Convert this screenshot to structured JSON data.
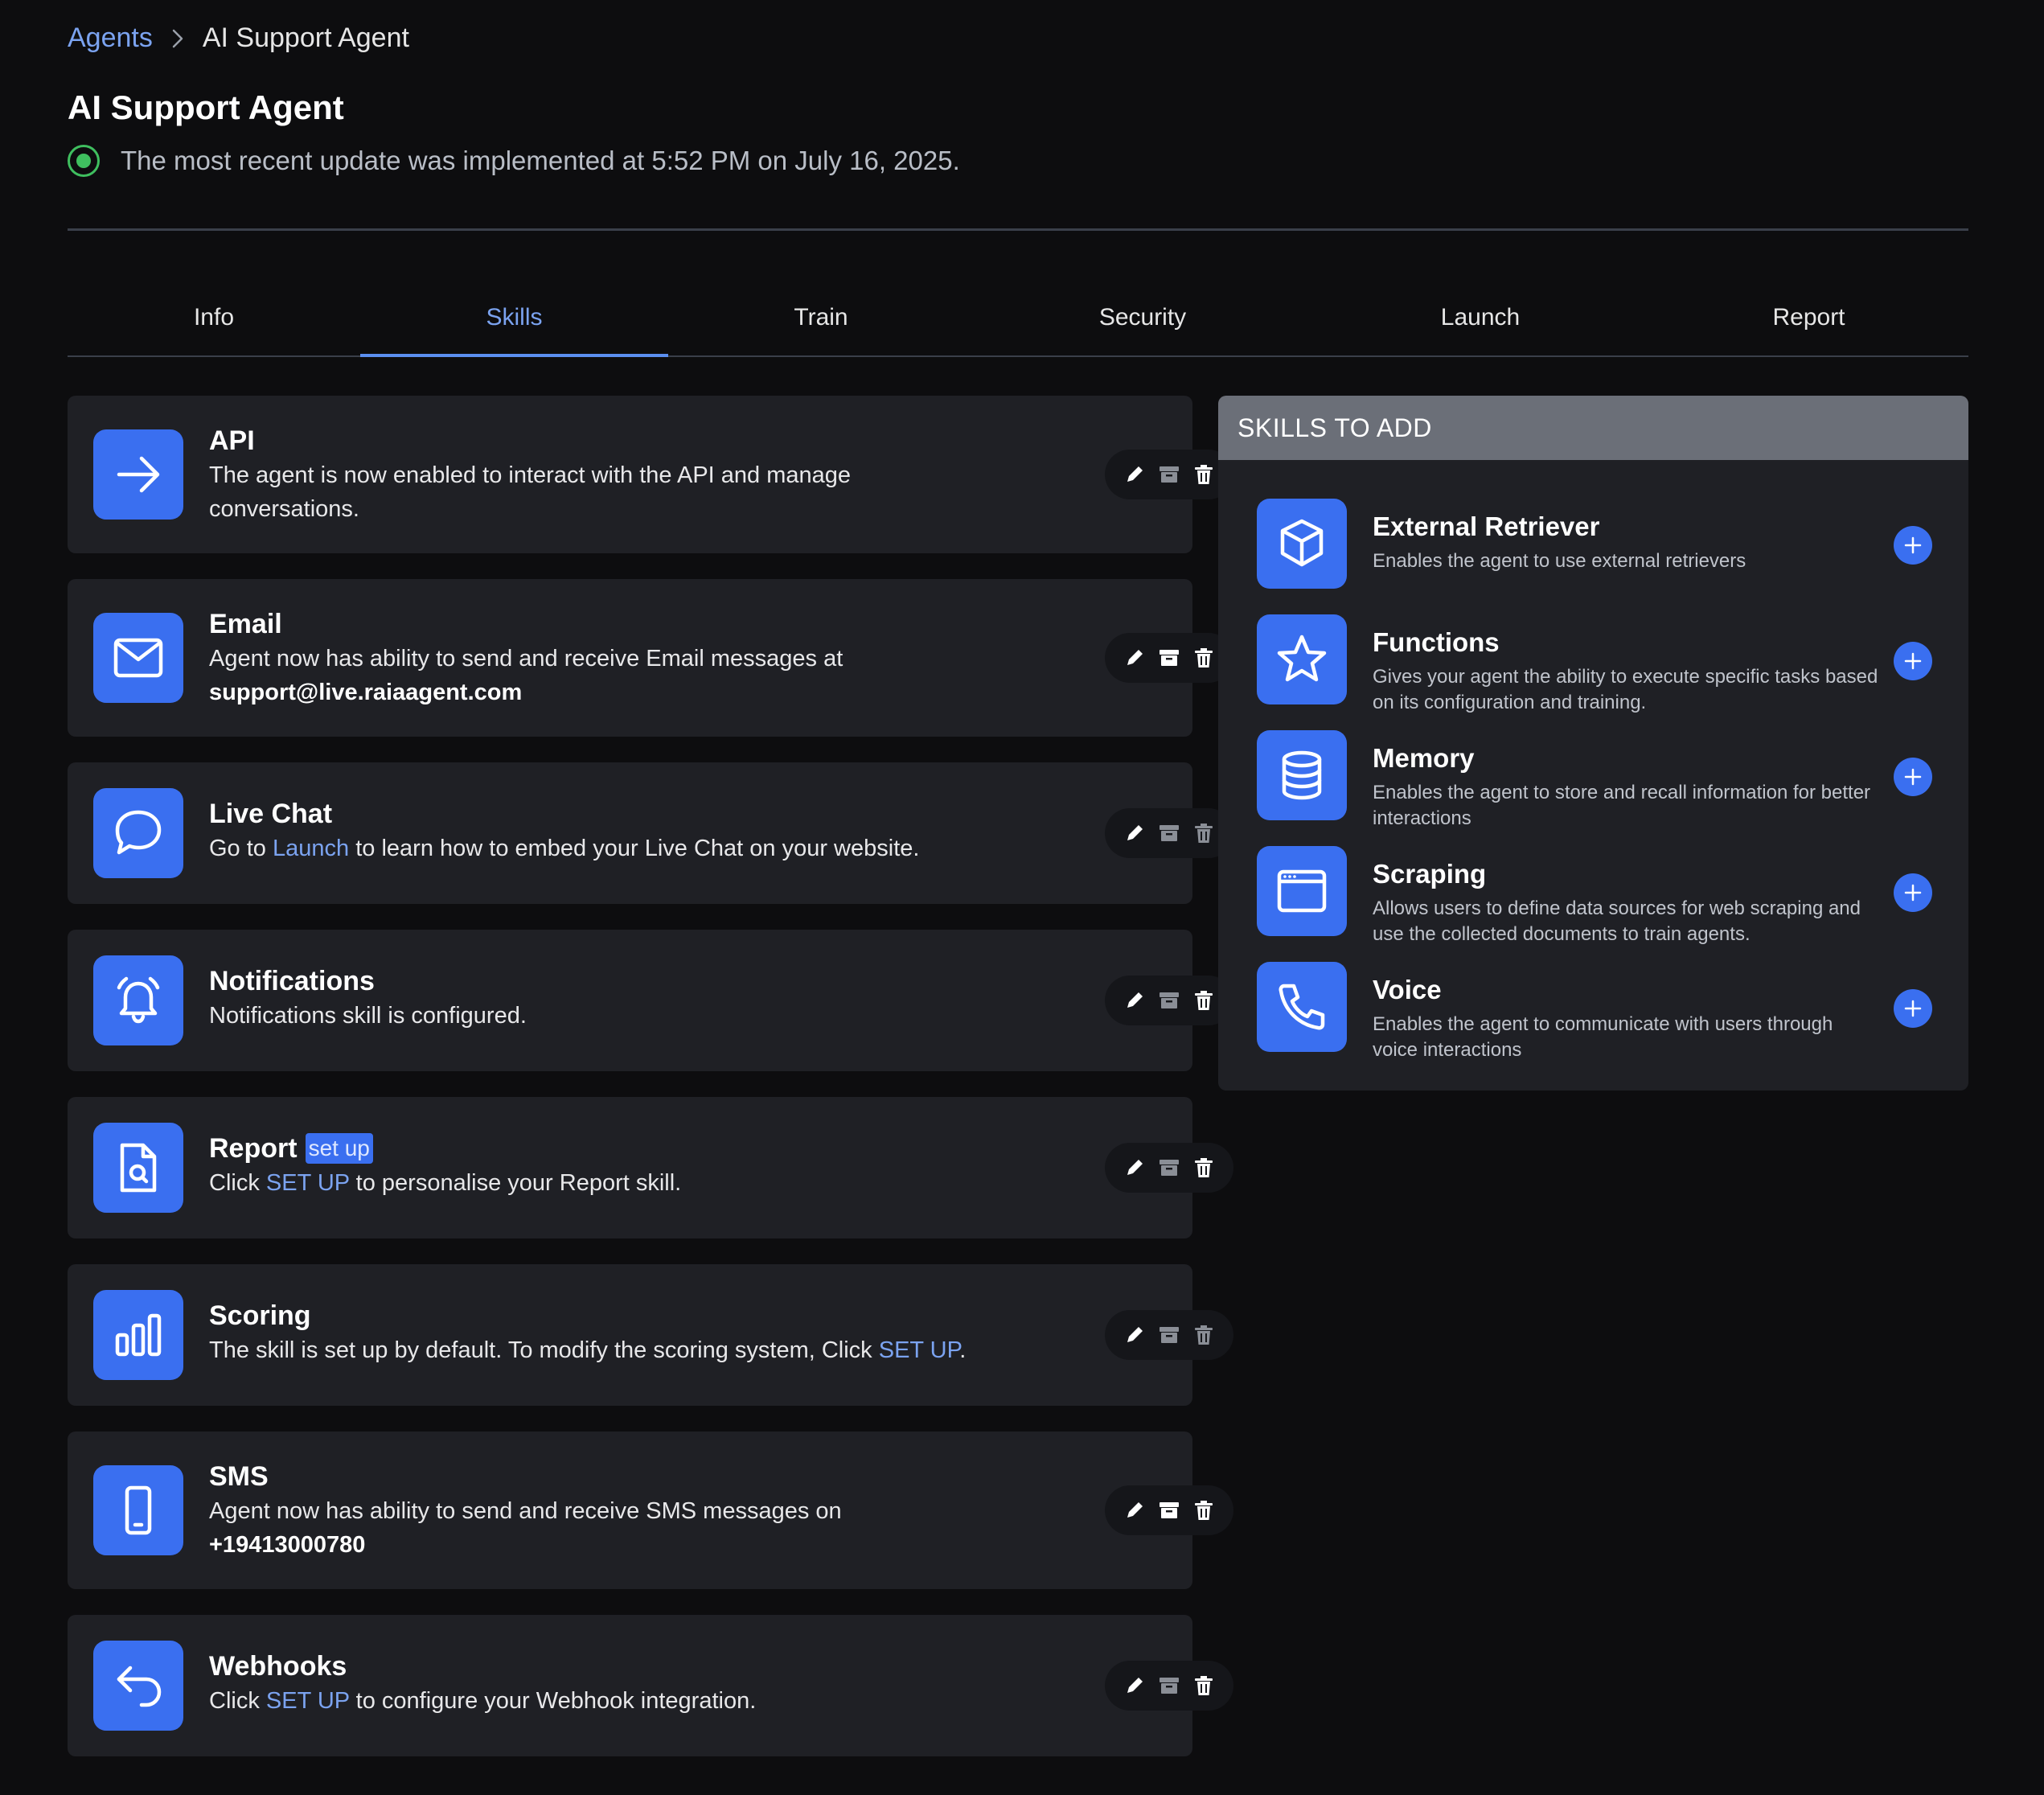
{
  "breadcrumb": {
    "parent": "Agents",
    "current": "AI Support Agent"
  },
  "page": {
    "title": "AI Support Agent",
    "status_text": "The most recent update was implemented at 5:52 PM on July 16, 2025."
  },
  "tabs": [
    "Info",
    "Skills",
    "Train",
    "Security",
    "Launch",
    "Report"
  ],
  "active_tab": "Skills",
  "skills": [
    {
      "title": "API",
      "icon": "arrow-right-icon",
      "desc": "The agent is now enabled to interact with the API and manage conversations."
    },
    {
      "title": "Email",
      "icon": "envelope-icon",
      "desc": "Agent now has ability to send and receive Email messages at",
      "desc_strong": "support@live.raiaagent.com"
    },
    {
      "title": "Live Chat",
      "icon": "chat-bubble-icon",
      "desc_pre": "Go to",
      "desc_link": "Launch",
      "desc_post": "to learn how to embed your Live Chat on your website."
    },
    {
      "title": "Notifications",
      "icon": "bell-icon",
      "desc": "Notifications skill is configured."
    },
    {
      "title": "Report",
      "tag": "set up",
      "icon": "document-search-icon",
      "desc_pre": "Click",
      "desc_link": "SET UP",
      "desc_post": "to personalise your Report skill."
    },
    {
      "title": "Scoring",
      "icon": "bar-chart-icon",
      "desc_pre": "The skill is set up by default. To modify the scoring system, Click",
      "desc_link": "SET UP",
      "desc_post": "."
    },
    {
      "title": "SMS",
      "icon": "mobile-phone-icon",
      "desc": "Agent now has ability to send and receive SMS messages on",
      "desc_strong": "+19413000780"
    },
    {
      "title": "Webhooks",
      "icon": "reply-arrow-icon",
      "desc_pre": "Click",
      "desc_link": "SET UP",
      "desc_post": "to configure your Webhook integration."
    }
  ],
  "skills_to_add": {
    "heading": "SKILLS TO ADD",
    "items": [
      {
        "title": "External Retriever",
        "icon": "cube-icon",
        "desc": "Enables the agent to use external retrievers"
      },
      {
        "title": "Functions",
        "icon": "star-icon",
        "desc": "Gives your agent the ability to execute specific tasks based on its configuration and training."
      },
      {
        "title": "Memory",
        "icon": "database-icon",
        "desc": "Enables the agent to store and recall information for better interactions"
      },
      {
        "title": "Scraping",
        "icon": "browser-window-icon",
        "desc": "Allows users to define data sources for web scraping and use the collected documents to train agents."
      },
      {
        "title": "Voice",
        "icon": "phone-icon",
        "desc": "Enables the agent to communicate with users through voice interactions"
      }
    ]
  },
  "colors": {
    "accent": "#3a6ff0",
    "link": "#7ba3f0",
    "card": "#1f2025",
    "background": "#0d0d0f",
    "status": "#3fbf5f"
  }
}
